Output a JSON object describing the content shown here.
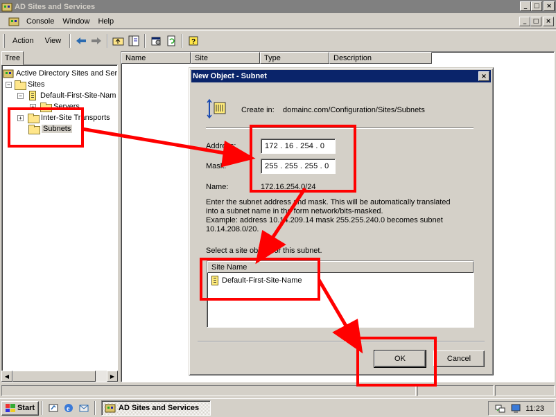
{
  "window": {
    "title": "AD Sites and Services",
    "caption_buttons": [
      "_",
      "□",
      "×"
    ]
  },
  "menu": {
    "items": [
      "Console",
      "Window",
      "Help"
    ],
    "mdi_buttons": [
      "_",
      "□",
      "×"
    ]
  },
  "toolbar": {
    "action_label": "Action",
    "view_label": "View",
    "icons": [
      "back-arrow-icon",
      "forward-arrow-icon",
      "up-folder-icon",
      "show-hide-tree-icon",
      "properties-icon",
      "refresh-icon",
      "help-icon"
    ]
  },
  "tree": {
    "tab_label": "Tree",
    "items": [
      {
        "label": "Active Directory Sites and Serv",
        "level": 0,
        "icon": "ad-sites-icon"
      },
      {
        "label": "Sites",
        "level": 1,
        "expander": "−",
        "icon": "folder-icon"
      },
      {
        "label": "Default-First-Site-Nam",
        "level": 2,
        "expander": "−",
        "icon": "site-icon"
      },
      {
        "label": "Servers",
        "level": 3,
        "expander": "+",
        "icon": "folder-icon"
      },
      {
        "label": "Inter-Site Transports",
        "level": 2,
        "expander": "+",
        "icon": "folder-icon"
      },
      {
        "label": "Subnets",
        "level": 2,
        "icon": "folder-icon",
        "selected": true
      }
    ]
  },
  "list": {
    "columns": [
      "Name",
      "Site",
      "Type",
      "Description"
    ]
  },
  "dialog": {
    "title": "New Object - Subnet",
    "close_label": "×",
    "create_in_label": "Create in:",
    "create_in_value": "domainc.com/Configuration/Sites/Subnets",
    "address_label": "Address:",
    "address_value": "172 .  16  . 254 .   0",
    "mask_label": "Mask:",
    "mask_value": "255 . 255 . 255 .   0",
    "name_label": "Name:",
    "name_value": "172.16.254.0/24",
    "help_lines": [
      "Enter the subnet address and mask. This will be automatically translated",
      "into a subnet name in the form network/bits-masked.",
      "Example: address 10.14.209.14 mask 255.255.240.0 becomes subnet",
      "10.14.208.0/20."
    ],
    "select_label": "Select a site object for this subnet.",
    "site_list_header": "Site Name",
    "site_items": [
      "Default-First-Site-Name"
    ],
    "ok_label": "OK",
    "cancel_label": "Cancel"
  },
  "taskbar": {
    "start_label": "Start",
    "task_label": "AD Sites and Services",
    "clock": "11:23"
  },
  "annotation_color": "#ff0000"
}
